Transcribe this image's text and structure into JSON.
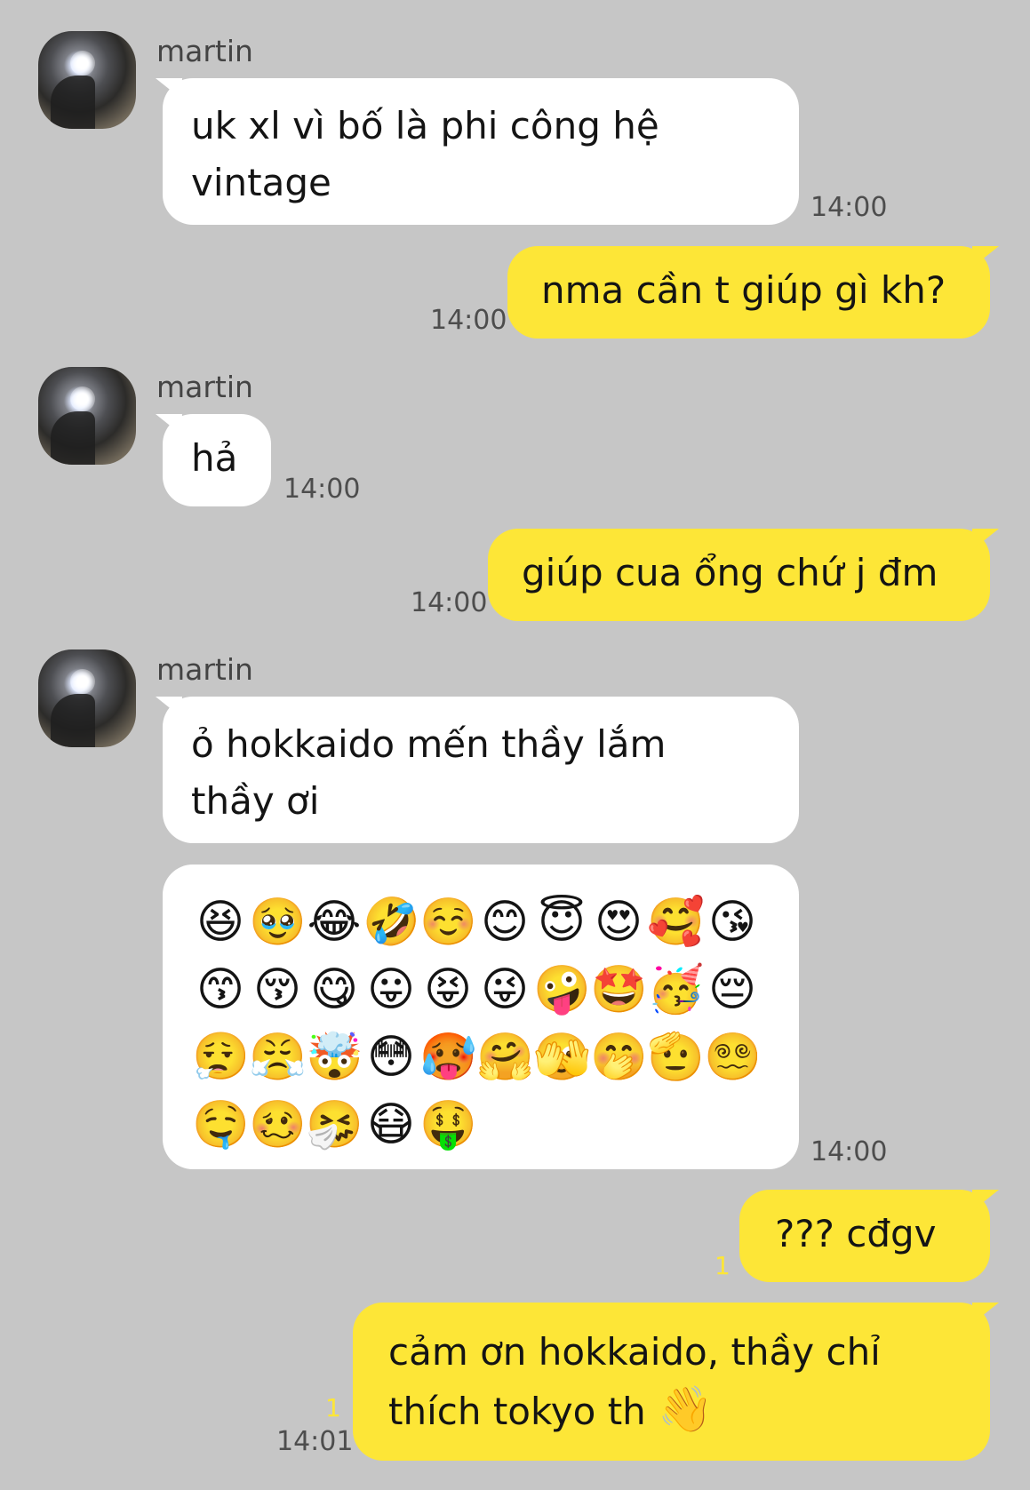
{
  "contact": {
    "name": "martin"
  },
  "messages": [
    {
      "from": "martin",
      "text_line1": "uk xl vì bố là phi công hệ",
      "text_line2": "vintage",
      "time": "14:00"
    },
    {
      "from": "me",
      "text": "nma cần t giúp gì kh?",
      "time": "14:00"
    },
    {
      "from": "martin",
      "text": "hả",
      "time": "14:00"
    },
    {
      "from": "me",
      "text": "giúp cua ổng chứ j đm",
      "time": "14:00"
    },
    {
      "from": "martin",
      "text_line1": "ỏ hokkaido mến thầy lắm",
      "text_line2": "thầy ơi"
    },
    {
      "from": "martin",
      "type": "emoji-block",
      "time": "14:00",
      "emojis": [
        "😆",
        "🥹",
        "😂",
        "🤣",
        "☺️",
        "😊",
        "😇",
        "😍",
        "🥰",
        "😘",
        "😙",
        "😚",
        "😋",
        "😛",
        "😝",
        "😜",
        "🤪",
        "🤩",
        "🥳",
        "😔",
        "😮‍💨",
        "😤",
        "🤯",
        "😳",
        "🥵",
        "🤗",
        "🫣",
        "🤭",
        "🫡",
        "😵‍💫",
        "🤤",
        "🥴",
        "🤧",
        "😷",
        "🤑"
      ]
    },
    {
      "from": "me",
      "text": "??? cđgv",
      "unread": "1"
    },
    {
      "from": "me",
      "text_line1": "cảm ơn hokkaido, thầy chỉ",
      "text_line2": "thích tokyo th",
      "emoji": "👋",
      "unread": "1",
      "time": "14:01"
    }
  ]
}
